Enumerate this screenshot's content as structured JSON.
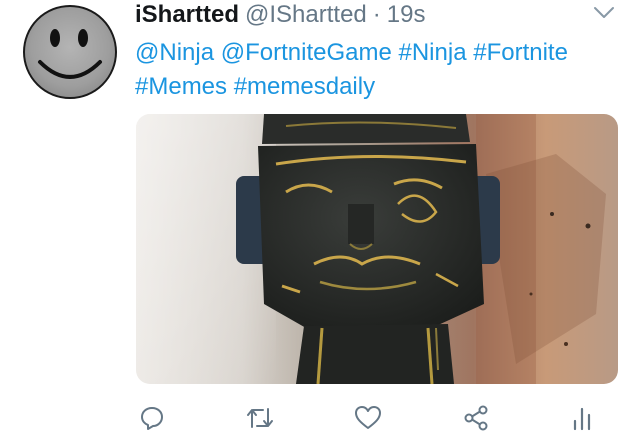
{
  "tweet": {
    "author": {
      "display_name": "iShartted",
      "handle": "@IShartted",
      "separator": "·",
      "timestamp": "19s"
    },
    "text": {
      "mentions": [
        "@Ninja",
        "@FortniteGame"
      ],
      "hashtags_line1": [
        "#Ninja",
        "#Fortnite"
      ],
      "hashtags_line2": [
        "#Memes",
        "#memesdaily"
      ]
    },
    "icons": {
      "avatar": "smiley-face-avatar",
      "caret": "chevron-down-icon",
      "reply": "reply-icon",
      "retweet": "retweet-icon",
      "like": "heart-icon",
      "share": "share-icon",
      "analytics": "analytics-icon"
    },
    "colors": {
      "link": "#1b95e0",
      "secondary": "#657786",
      "icon": "#657786"
    }
  }
}
